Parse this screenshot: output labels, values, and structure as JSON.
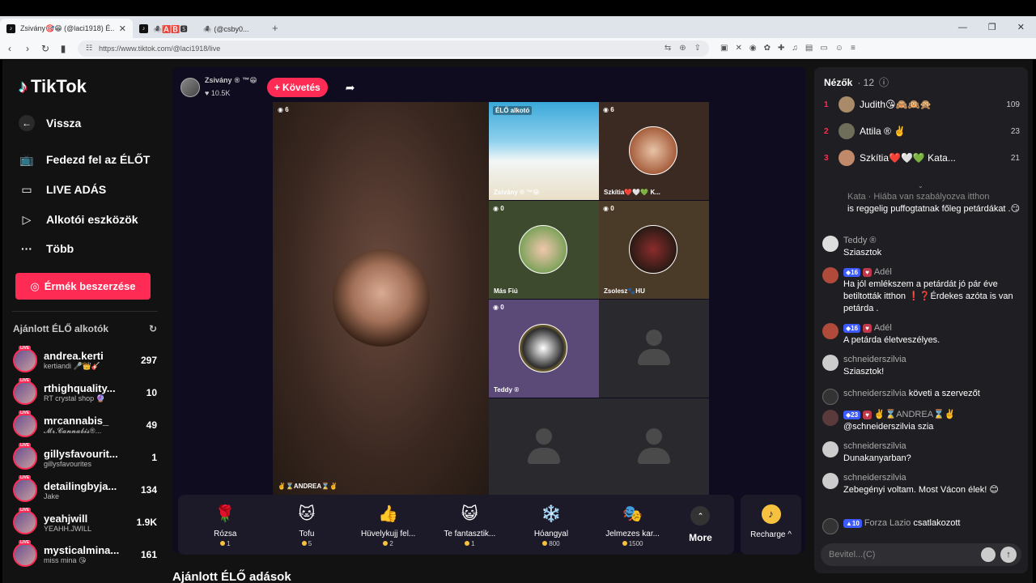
{
  "browser": {
    "tabs": [
      {
        "title": "Zsivány🎯😁 (@laci1918) É...",
        "active": true
      },
      {
        "title": "🕷️🅰️🅱️🆂 ㅤㅤ🕷️ (@csby0...",
        "active": false
      }
    ],
    "url": "https://www.tiktok.com/@laci1918/live"
  },
  "sidebar": {
    "logo": "TikTok",
    "nav": [
      {
        "label": "Vissza",
        "icon": "arrow-left-icon"
      },
      {
        "label": "Fedezd fel az ÉLŐT",
        "icon": "tv-icon"
      },
      {
        "label": "LIVE ADÁS",
        "icon": "camera-icon"
      },
      {
        "label": "Alkotói eszközök",
        "icon": "play-box-icon"
      },
      {
        "label": "Több",
        "icon": "more-icon"
      }
    ],
    "coins_button": "Érmék beszerzése",
    "recommended_title": "Ajánlott ÉLŐ alkotók",
    "live_badge": "LIVE",
    "recommended": [
      {
        "name": "andrea.kerti",
        "sub": "kertiandi 🎤👑🎸",
        "count": "297"
      },
      {
        "name": "rthighquality...",
        "sub": "RT crystal shop 🔮",
        "count": "10"
      },
      {
        "name": "mrcannabis_",
        "sub": "𝓜𝓻.𝓒𝓪𝓷𝓷𝓪𝓫𝓲𝓼®...",
        "count": "49"
      },
      {
        "name": "gillysfavourit...",
        "sub": "gillysfavourites",
        "count": "1"
      },
      {
        "name": "detailingbyja...",
        "sub": "Jake",
        "count": "134"
      },
      {
        "name": "yeahjwill",
        "sub": "YEAHH.JWILL",
        "count": "1.9K"
      },
      {
        "name": "mysticalmina...",
        "sub": "miss mina 😘",
        "count": "161"
      }
    ]
  },
  "stream": {
    "host_name": "Zsivány",
    "host_suffix": "™😁",
    "host_likes": "10.5K",
    "follow_label": "+ Követés",
    "big_tile_label": "✌️⌛ANDREA⌛✌️",
    "tiles": [
      {
        "label": "Zsivány ® ™😁",
        "count": "ÉLŐ alkotó",
        "type": "beach"
      },
      {
        "label": "Szkítia❤️🤍💚 K...",
        "count": "6",
        "type": "face"
      },
      {
        "label": "Más Fiú",
        "count": "0",
        "type": "face"
      },
      {
        "label": "Zsolesz🐾HU",
        "count": "0",
        "type": "face"
      },
      {
        "label": "Teddy ®",
        "count": "0",
        "type": "face"
      },
      {
        "label": "",
        "count": "",
        "type": "empty"
      },
      {
        "label": "",
        "count": "",
        "type": "empty"
      },
      {
        "label": "",
        "count": "",
        "type": "empty"
      }
    ],
    "big_tile_count": "6"
  },
  "gifts": [
    {
      "name": "Rózsa",
      "price": "1",
      "emoji": "🌹"
    },
    {
      "name": "Tofu",
      "price": "5",
      "emoji": "🐱"
    },
    {
      "name": "Hüvelykujj fel...",
      "price": "2",
      "emoji": "👍"
    },
    {
      "name": "Te fantasztik...",
      "price": "1",
      "emoji": "😺"
    },
    {
      "name": "Hóangyal",
      "price": "800",
      "emoji": "❄️"
    },
    {
      "name": "Jelmezes kar...",
      "price": "1500",
      "emoji": "🎭"
    }
  ],
  "more_label": "More",
  "recharge_label": "Recharge ^",
  "recommended_below": "Ajánlott ÉLŐ adások",
  "chat": {
    "viewers_label": "Nézők",
    "viewers_count": "· 12",
    "top_viewers": [
      {
        "rank": "1",
        "name": "Judith😘🙈🙉🙊",
        "count": "109"
      },
      {
        "rank": "2",
        "name": "Attila ® ✌️",
        "count": "23"
      },
      {
        "rank": "3",
        "name": "Szkítia❤️🤍💚 Kata...",
        "count": "21"
      }
    ],
    "messages": [
      {
        "user": "Kata · Hiába van szabályozva itthon",
        "text": "is reggelig puffogtatnak főleg petárdákat .😏",
        "badge": ""
      },
      {
        "user": "Teddy ®",
        "text": "Sziasztok",
        "badge": ""
      },
      {
        "user": "Adél",
        "text": "Ha jól emlékszem a petárdát jó pár éve betiltották itthon ❗❓Érdekes azóta is van petárda .",
        "badge": "16"
      },
      {
        "user": "Adél",
        "text": "A petárda életveszélyes.",
        "badge": "16"
      },
      {
        "user": "schneiderszilvia",
        "text": "Sziasztok!",
        "badge": ""
      },
      {
        "user": "schneiderszilvia",
        "text": "követi a szervezőt",
        "badge": ""
      },
      {
        "user": "✌️⌛ANDREA⌛✌️",
        "text": "@schneiderszilvia szia",
        "badge": "23"
      },
      {
        "user": "schneiderszilvia",
        "text": "Dunakanyarban?",
        "badge": ""
      },
      {
        "user": "schneiderszilvia",
        "text": "Zebegényi voltam. Most Vácon élek! 😊",
        "badge": ""
      },
      {
        "user": "Forza Lazio",
        "text": "csatlakozott",
        "badge": "10"
      }
    ],
    "input_placeholder": "Bevitel...(C)"
  }
}
